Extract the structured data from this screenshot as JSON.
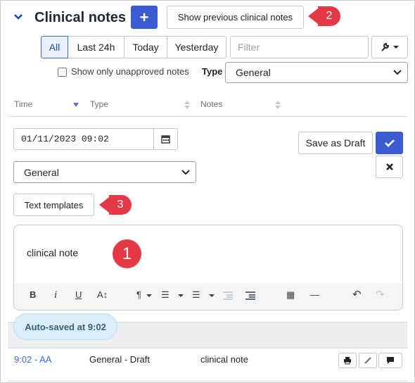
{
  "header": {
    "title": "Clinical notes",
    "add_label": "+",
    "show_previous_label": "Show previous clinical notes",
    "badge_two": "2"
  },
  "filters": {
    "segments": [
      "All",
      "Last 24h",
      "Today",
      "Yesterday"
    ],
    "filter_placeholder": "Filter",
    "unapproved_label": "Show only unapproved notes",
    "type_label": "Type",
    "type_value": "General"
  },
  "table": {
    "columns": [
      "Time",
      "Type",
      "Notes"
    ]
  },
  "editor": {
    "datetime": "01/11/2023 09:02",
    "save_draft_label": "Save as Draft",
    "type_value": "General",
    "text_templates_label": "Text templates",
    "badge_three": "3",
    "note_text": "clinical note",
    "badge_one": "1",
    "toolbar": {
      "bold": "B",
      "italic": "i",
      "underline": "U",
      "font_size": "A↕",
      "paragraph": "¶",
      "ordered_list": "☰",
      "bullet_list": "☰",
      "table": "▦",
      "hr": "—",
      "undo": "↶",
      "redo": "↷"
    },
    "autosave": "Auto-saved at 9:02"
  },
  "rows": [
    {
      "time": "9:02 - AA",
      "type": "General - Draft",
      "notes": "clinical note"
    }
  ],
  "colors": {
    "accent": "#3a5cd0",
    "badge": "#e63946",
    "link": "#3a6fd8"
  }
}
